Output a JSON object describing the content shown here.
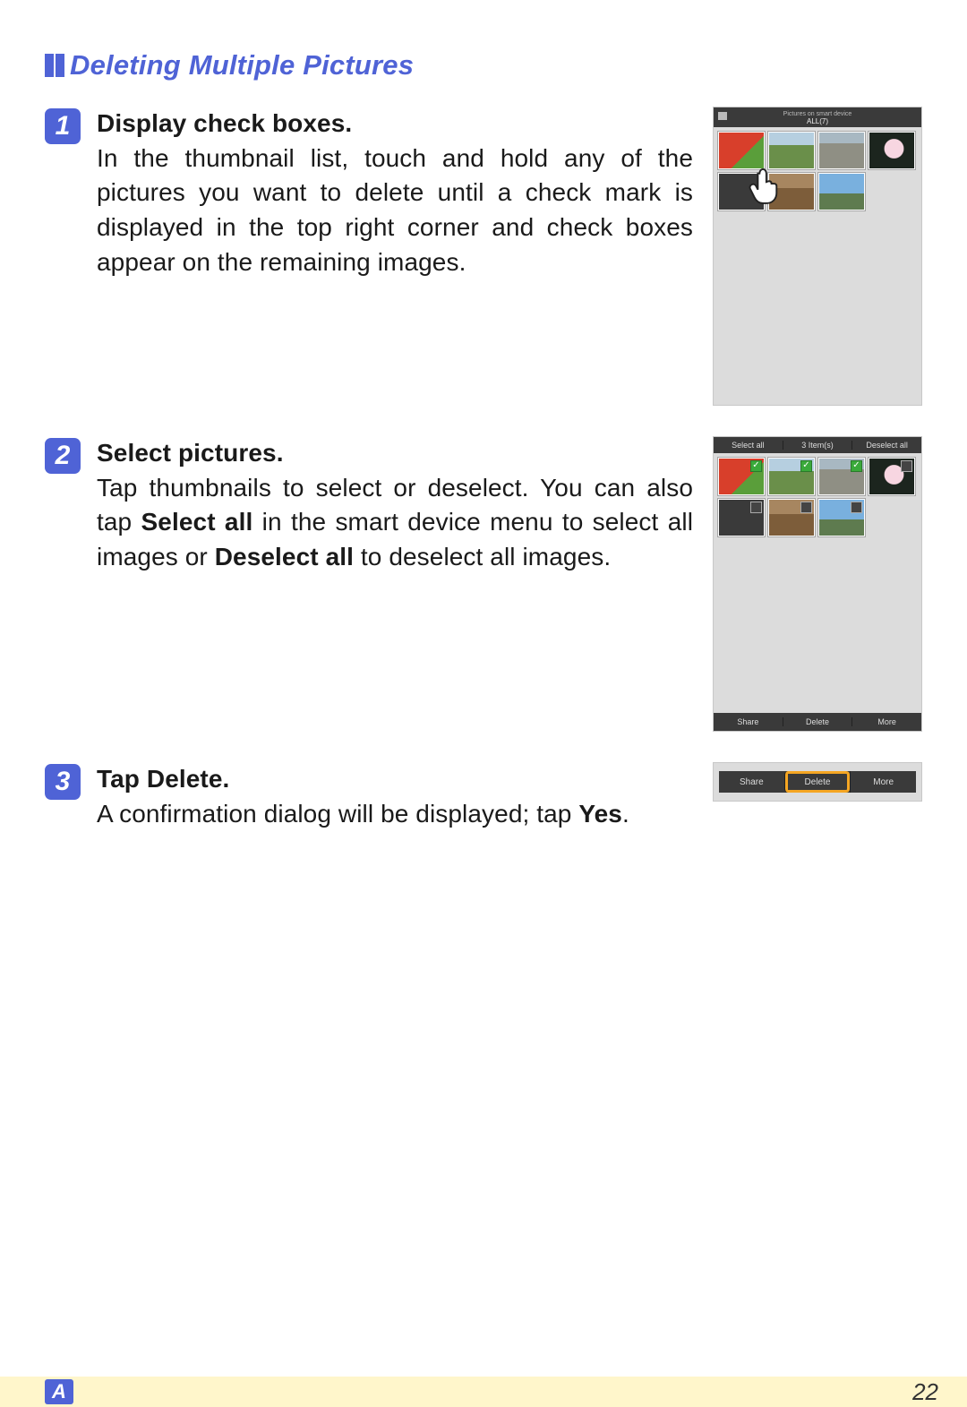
{
  "section": {
    "title": "Deleting Multiple Pictures"
  },
  "steps": [
    {
      "num": "1",
      "head": "Display check boxes.",
      "body": "In the thumbnail list, touch and hold any of the pictures you want to delete until a check mark is displayed in the top right corner and check boxes appear on the remaining images."
    },
    {
      "num": "2",
      "head": "Select pictures.",
      "body_pre": "Tap thumbnails to select or deselect. You can also tap ",
      "body_b1": "Select all",
      "body_mid": " in the smart device menu to select all images or ",
      "body_b2": "De­select all",
      "body_post": " to deselect all images."
    },
    {
      "num": "3",
      "head_pre": "Tap ",
      "head_b": "Delete",
      "head_post": ".",
      "body_pre": "A confirmation dialog will be displayed; tap ",
      "body_b": "Yes",
      "body_post": "."
    }
  ],
  "fig1": {
    "header_top": "Pictures on smart device",
    "header_sub": "ALL(7)"
  },
  "fig2": {
    "top_select_all": "Select all",
    "top_count": "3 Item(s)",
    "top_deselect_all": "Deselect all",
    "bottom_share": "Share",
    "bottom_delete": "Delete",
    "bottom_more": "More"
  },
  "fig3": {
    "share": "Share",
    "delete": "Delete",
    "more": "More"
  },
  "footer": {
    "tab": "A",
    "page": "22"
  }
}
